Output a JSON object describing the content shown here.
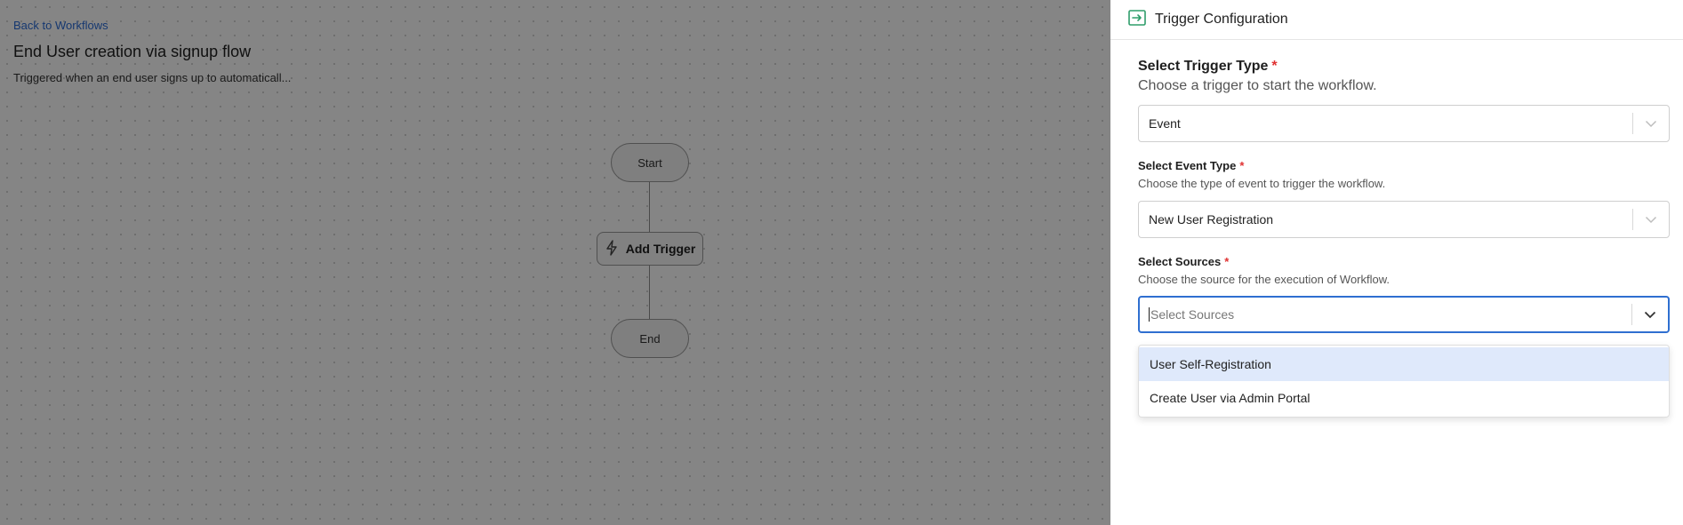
{
  "canvas": {
    "back_link": "Back to Workflows",
    "title": "End User creation via signup flow",
    "description": "Triggered when an end user signs up to automaticall...",
    "nodes": {
      "start": "Start",
      "trigger": "Add Trigger",
      "end": "End"
    }
  },
  "panel": {
    "title": "Trigger Configuration",
    "trigger_type": {
      "label": "Select Trigger Type",
      "required": "*",
      "help": "Choose a trigger to start the workflow.",
      "value": "Event"
    },
    "event_type": {
      "label": "Select Event Type",
      "required": "*",
      "help": "Choose the type of event to trigger the workflow.",
      "value": "New User Registration"
    },
    "sources": {
      "label": "Select Sources",
      "required": "*",
      "help": "Choose the source for the execution of Workflow.",
      "placeholder": "Select Sources",
      "options": [
        {
          "label": "User Self-Registration"
        },
        {
          "label": "Create User via Admin Portal"
        }
      ]
    }
  },
  "colors": {
    "accent": "#2f6fd0",
    "link": "#2b6cd6",
    "required": "#e03131",
    "icon_green": "#2e9d6a",
    "option_highlight": "#dfe9fb"
  },
  "icons": {
    "header": "trigger-enter-icon",
    "trigger_node": "lightning-icon",
    "chevron": "chevron-down-icon"
  }
}
